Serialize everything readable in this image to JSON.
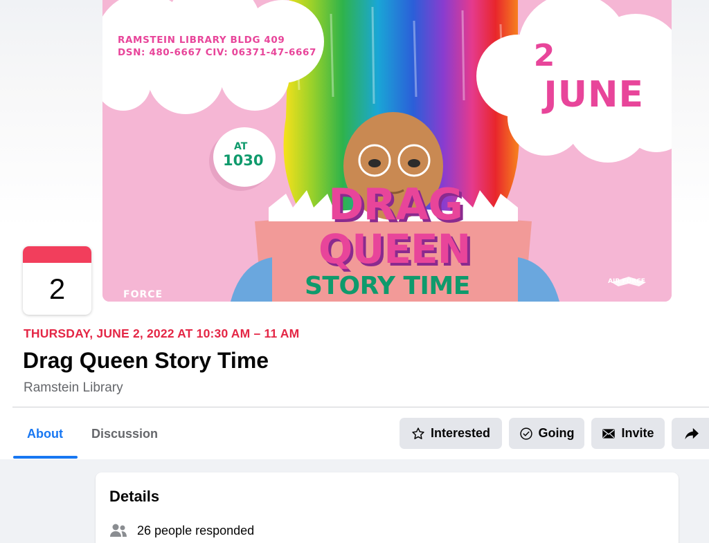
{
  "banner": {
    "address_line1": "RAMSTEIN LIBRARY BLDG 409",
    "address_line2": "DSN: 480-6667 CIV: 06371-47-6667",
    "day": "2",
    "month": "JUNE",
    "at_label": "AT",
    "at_time": "1030",
    "title_line1": "DRAG",
    "title_line2": "QUEEN",
    "title_line3": "STORY TIME",
    "brand_left": "FORCE",
    "brand_right": "AIR FORCE"
  },
  "date_card": {
    "day": "2",
    "accent_color": "#f23e5c"
  },
  "event": {
    "date_time": "THURSDAY, JUNE 2, 2022 AT 10:30 AM – 11 AM",
    "title": "Drag Queen Story Time",
    "host": "Ramstein Library"
  },
  "tabs": [
    {
      "label": "About",
      "active": true
    },
    {
      "label": "Discussion",
      "active": false
    }
  ],
  "actions": {
    "interested": {
      "label": "Interested",
      "icon": "star-outline-icon"
    },
    "going": {
      "label": "Going",
      "icon": "check-circle-icon"
    },
    "invite": {
      "label": "Invite",
      "icon": "envelope-icon"
    },
    "share": {
      "label": "",
      "icon": "share-arrow-icon"
    }
  },
  "details": {
    "heading": "Details",
    "responded": "26 people responded",
    "responded_icon": "people-icon"
  },
  "colors": {
    "accent_blue": "#1877f2",
    "date_red": "#e42645",
    "button_bg": "#e4e6eb",
    "banner_pink": "#f5b6d4",
    "banner_magenta": "#e8459a",
    "banner_green": "#0f9a6c"
  }
}
